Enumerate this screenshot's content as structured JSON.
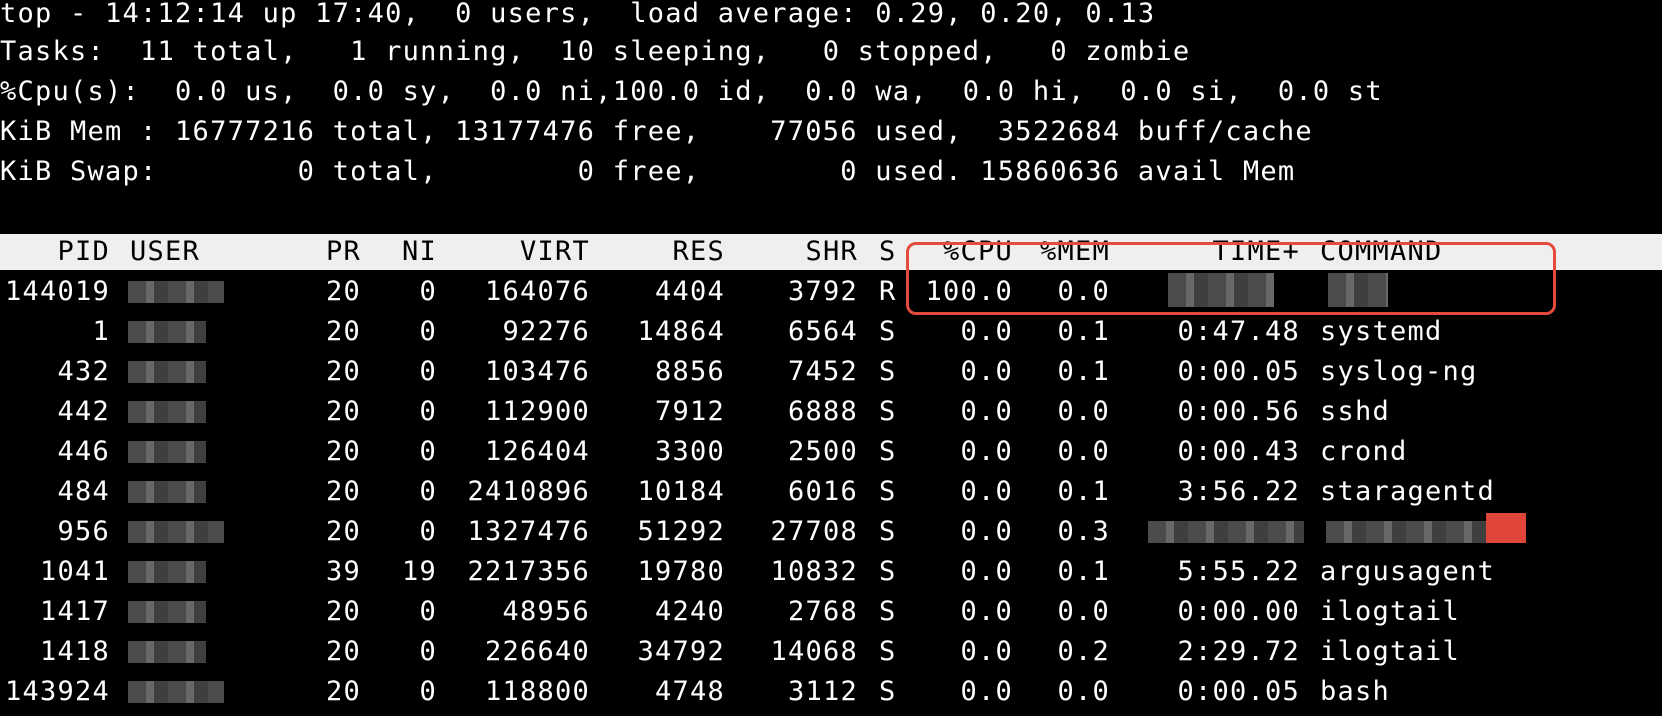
{
  "summary": {
    "line1": "top - 14:12:14 up 17:40,  0 users,  load average: 0.29, 0.20, 0.13",
    "line2": "Tasks:  11 total,   1 running,  10 sleeping,   0 stopped,   0 zombie",
    "line3": "%Cpu(s):  0.0 us,  0.0 sy,  0.0 ni,100.0 id,  0.0 wa,  0.0 hi,  0.0 si,  0.0 st",
    "line4": "KiB Mem : 16777216 total, 13177476 free,    77056 used,  3522684 buff/cache",
    "line5": "KiB Swap:        0 total,        0 free,        0 used. 15860636 avail Mem"
  },
  "columns": {
    "pid": "PID",
    "user": "USER",
    "pr": "PR",
    "ni": "NI",
    "virt": "VIRT",
    "res": "RES",
    "shr": "SHR",
    "s": "S",
    "cpu": "%CPU",
    "mem": "%MEM",
    "time": "TIME+",
    "command": "COMMAND"
  },
  "processes": [
    {
      "pid": "144019",
      "pr": "20",
      "ni": "0",
      "virt": "164076",
      "res": "4404",
      "shr": "3792",
      "s": "R",
      "cpu": "100.0",
      "mem": "0.0",
      "time": "",
      "command": ""
    },
    {
      "pid": "1",
      "pr": "20",
      "ni": "0",
      "virt": "92276",
      "res": "14864",
      "shr": "6564",
      "s": "S",
      "cpu": "0.0",
      "mem": "0.1",
      "time": "0:47.48",
      "command": "systemd"
    },
    {
      "pid": "432",
      "pr": "20",
      "ni": "0",
      "virt": "103476",
      "res": "8856",
      "shr": "7452",
      "s": "S",
      "cpu": "0.0",
      "mem": "0.1",
      "time": "0:00.05",
      "command": "syslog-ng"
    },
    {
      "pid": "442",
      "pr": "20",
      "ni": "0",
      "virt": "112900",
      "res": "7912",
      "shr": "6888",
      "s": "S",
      "cpu": "0.0",
      "mem": "0.0",
      "time": "0:00.56",
      "command": "sshd"
    },
    {
      "pid": "446",
      "pr": "20",
      "ni": "0",
      "virt": "126404",
      "res": "3300",
      "shr": "2500",
      "s": "S",
      "cpu": "0.0",
      "mem": "0.0",
      "time": "0:00.43",
      "command": "crond"
    },
    {
      "pid": "484",
      "pr": "20",
      "ni": "0",
      "virt": "2410896",
      "res": "10184",
      "shr": "6016",
      "s": "S",
      "cpu": "0.0",
      "mem": "0.1",
      "time": "3:56.22",
      "command": "staragentd"
    },
    {
      "pid": "956",
      "pr": "20",
      "ni": "0",
      "virt": "1327476",
      "res": "51292",
      "shr": "27708",
      "s": "S",
      "cpu": "0.0",
      "mem": "0.3",
      "time": "",
      "command": ""
    },
    {
      "pid": "1041",
      "pr": "39",
      "ni": "19",
      "virt": "2217356",
      "res": "19780",
      "shr": "10832",
      "s": "S",
      "cpu": "0.0",
      "mem": "0.1",
      "time": "5:55.22",
      "command": "argusagent"
    },
    {
      "pid": "1417",
      "pr": "20",
      "ni": "0",
      "virt": "48956",
      "res": "4240",
      "shr": "2768",
      "s": "S",
      "cpu": "0.0",
      "mem": "0.0",
      "time": "0:00.00",
      "command": "ilogtail"
    },
    {
      "pid": "1418",
      "pr": "20",
      "ni": "0",
      "virt": "226640",
      "res": "34792",
      "shr": "14068",
      "s": "S",
      "cpu": "0.0",
      "mem": "0.2",
      "time": "2:29.72",
      "command": "ilogtail"
    },
    {
      "pid": "143924",
      "pr": "20",
      "ni": "0",
      "virt": "118800",
      "res": "4748",
      "shr": "3112",
      "s": "S",
      "cpu": "0.0",
      "mem": "0.0",
      "time": "0:00.05",
      "command": "bash"
    }
  ],
  "colors": {
    "background": "#000000",
    "foreground": "#ffffff",
    "header_bar": "#efefef",
    "highlight_box": "#e44b3c"
  }
}
